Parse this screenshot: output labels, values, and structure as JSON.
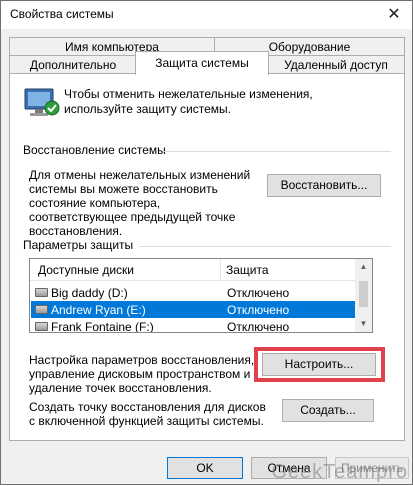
{
  "window": {
    "title": "Свойства системы",
    "close_glyph": "✕"
  },
  "tabs": {
    "row_back": [
      "Имя компьютера",
      "Оборудование"
    ],
    "row_front": [
      "Дополнительно",
      "Защита системы",
      "Удаленный доступ"
    ]
  },
  "intro": {
    "text": "Чтобы отменить нежелательные изменения, используйте защиту системы."
  },
  "restore": {
    "title": "Восстановление системы",
    "text": "Для отмены нежелательных изменений системы вы можете восстановить состояние компьютера, соответствующее предыдущей точке восстановления.",
    "button": "Восстановить..."
  },
  "protection": {
    "title": "Параметры защиты",
    "columns": [
      "Доступные диски",
      "Защита"
    ],
    "rows": [
      {
        "name": "Big daddy (D:)",
        "status": "Отключено"
      },
      {
        "name": "Andrew Ryan (E:)",
        "status": "Отключено"
      },
      {
        "name": "Frank Fontaine (F:)",
        "status": "Отключено"
      }
    ]
  },
  "configure": {
    "text": "Настройка параметров восстановления, управление дисковым пространством и удаление точек восстановления.",
    "button": "Настроить..."
  },
  "create": {
    "text": "Создать точку восстановления для дисков с включенной функцией защиты системы.",
    "button": "Создать..."
  },
  "footer": {
    "ok": "OK",
    "cancel": "Отмена",
    "apply": "Применить"
  },
  "watermark": "GeekTeampro",
  "colors": {
    "selection": "#0078d7",
    "highlight": "#e0414b"
  }
}
